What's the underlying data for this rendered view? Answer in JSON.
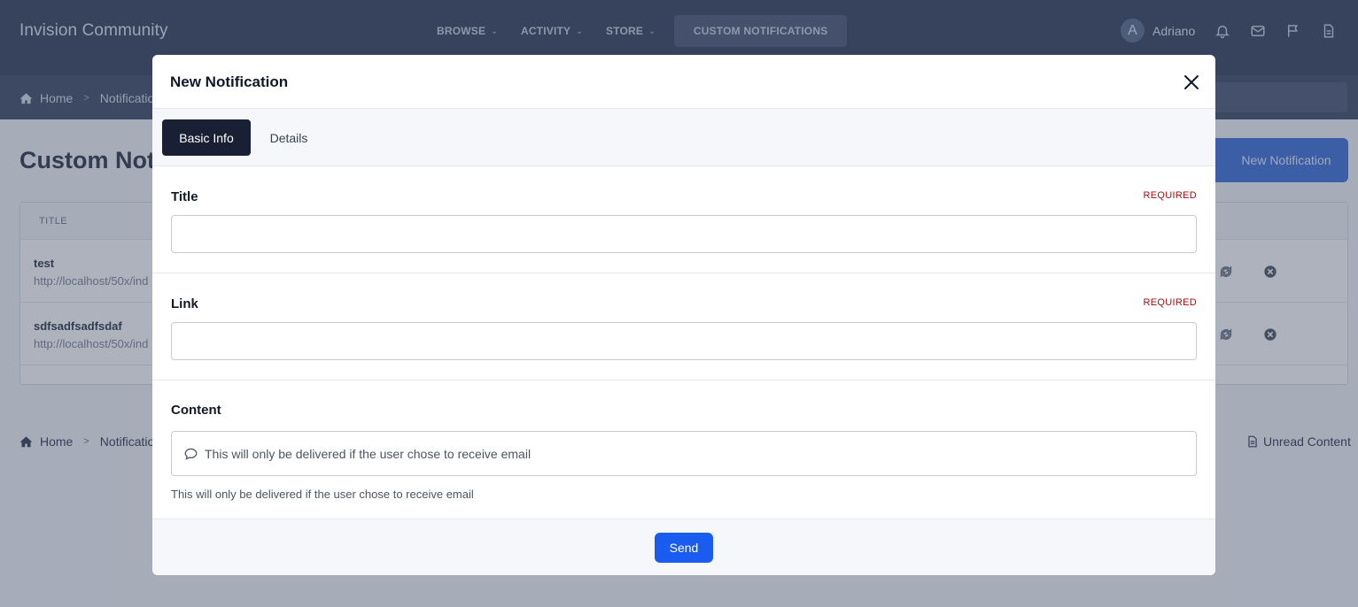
{
  "header": {
    "brand": "Invision Community",
    "nav": [
      {
        "label": "BROWSE"
      },
      {
        "label": "ACTIVITY"
      },
      {
        "label": "STORE"
      },
      {
        "label": "CUSTOM NOTIFICATIONS"
      }
    ],
    "user": {
      "initial": "A",
      "name": "Adriano"
    }
  },
  "breadcrumb": {
    "home": "Home",
    "current": "Notification"
  },
  "page": {
    "title": "Custom Not",
    "new_button": "New Notification",
    "table": {
      "column_title": "TITLE",
      "rows": [
        {
          "title": "test",
          "link": "http://localhost/50x/ind"
        },
        {
          "title": "sdfsadfsadfsdaf",
          "link": "http://localhost/50x/ind"
        }
      ]
    },
    "unread_content": "Unread Content"
  },
  "modal": {
    "title": "New Notification",
    "tabs": [
      {
        "label": "Basic Info",
        "active": true
      },
      {
        "label": "Details",
        "active": false
      }
    ],
    "fields": {
      "title": {
        "label": "Title",
        "required": "REQUIRED",
        "value": ""
      },
      "link": {
        "label": "Link",
        "required": "REQUIRED",
        "value": ""
      },
      "content": {
        "label": "Content",
        "placeholder": "This will only be delivered if the user chose to receive email",
        "hint": "This will only be delivered if the user chose to receive email"
      }
    },
    "send_label": "Send"
  },
  "colors": {
    "topbar": "#34405a",
    "primary": "#1a5cf0",
    "active_tab": "#1a2034",
    "required": "#a50f0f"
  }
}
